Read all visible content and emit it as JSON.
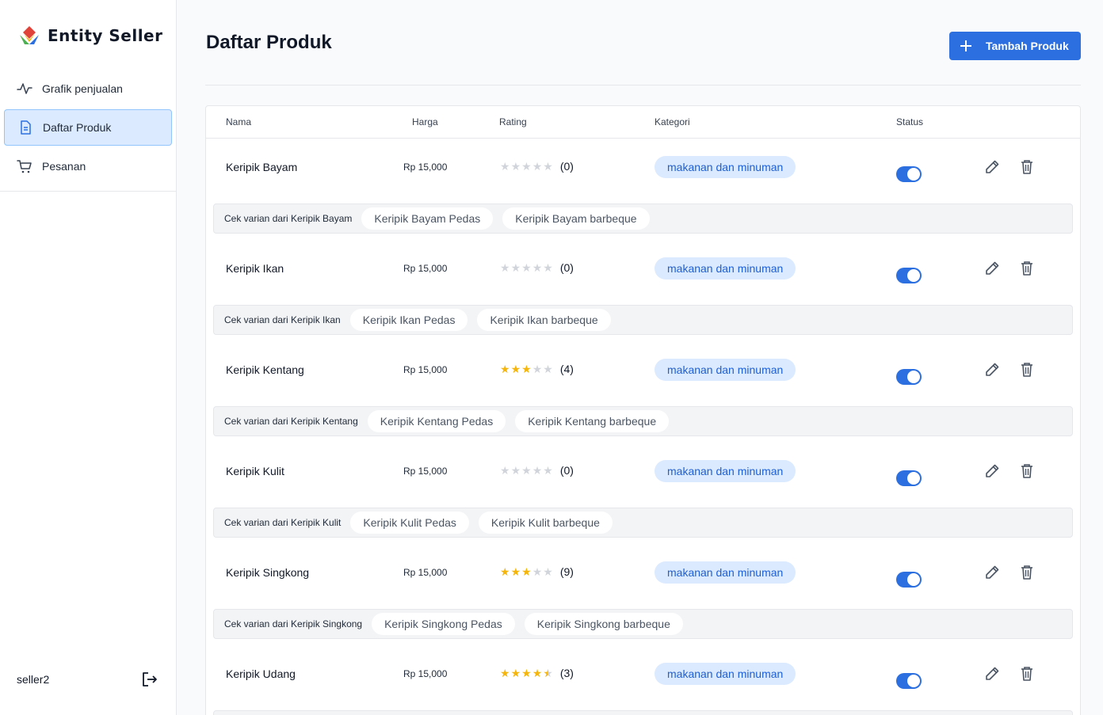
{
  "brand": {
    "name": "Entity Seller"
  },
  "sidebar": {
    "items": [
      {
        "label": "Grafik penjualan",
        "icon": "activity-icon",
        "active": false
      },
      {
        "label": "Daftar Produk",
        "icon": "document-icon",
        "active": true
      },
      {
        "label": "Pesanan",
        "icon": "cart-icon",
        "active": false
      }
    ],
    "user": "seller2"
  },
  "header": {
    "title": "Daftar Produk",
    "add_label": "Tambah Produk"
  },
  "colors": {
    "primary": "#2b6fe0",
    "chip_bg": "#dbeafe",
    "star": "#f5b50a"
  },
  "table": {
    "columns": {
      "name": "Nama",
      "price": "Harga",
      "rating": "Rating",
      "category": "Kategori",
      "status": "Status"
    },
    "rows": [
      {
        "name": "Keripik Bayam",
        "price": "Rp 15,000",
        "rating": 0,
        "count": "(0)",
        "category": "makanan dan minuman",
        "status": true,
        "variant_label": "Cek varian dari Keripik Bayam",
        "variants": [
          "Keripik Bayam Pedas",
          "Keripik Bayam barbeque"
        ]
      },
      {
        "name": "Keripik Ikan",
        "price": "Rp 15,000",
        "rating": 0,
        "count": "(0)",
        "category": "makanan dan minuman",
        "status": true,
        "variant_label": "Cek varian dari Keripik Ikan",
        "variants": [
          "Keripik Ikan Pedas",
          "Keripik Ikan barbeque"
        ]
      },
      {
        "name": "Keripik Kentang",
        "price": "Rp 15,000",
        "rating": 3,
        "count": "(4)",
        "category": "makanan dan minuman",
        "status": true,
        "variant_label": "Cek varian dari Keripik Kentang",
        "variants": [
          "Keripik Kentang Pedas",
          "Keripik Kentang barbeque"
        ]
      },
      {
        "name": "Keripik Kulit",
        "price": "Rp 15,000",
        "rating": 0,
        "count": "(0)",
        "category": "makanan dan minuman",
        "status": true,
        "variant_label": "Cek varian dari Keripik Kulit",
        "variants": [
          "Keripik Kulit Pedas",
          "Keripik Kulit barbeque"
        ]
      },
      {
        "name": "Keripik Singkong",
        "price": "Rp 15,000",
        "rating": 3,
        "count": "(9)",
        "category": "makanan dan minuman",
        "status": true,
        "variant_label": "Cek varian dari Keripik Singkong",
        "variants": [
          "Keripik Singkong Pedas",
          "Keripik Singkong barbeque"
        ]
      },
      {
        "name": "Keripik Udang",
        "price": "Rp 15,000",
        "rating": 4.5,
        "count": "(3)",
        "category": "makanan dan minuman",
        "status": true,
        "variant_label": "",
        "variants": []
      }
    ]
  }
}
